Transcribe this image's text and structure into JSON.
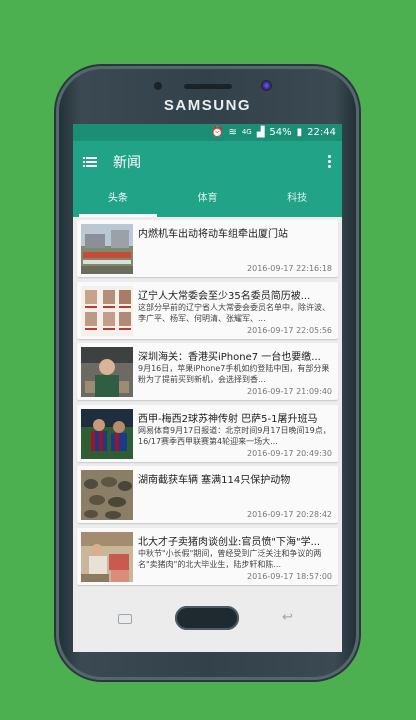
{
  "device": {
    "brand": "SAMSUNG"
  },
  "status_bar": {
    "network": "4G",
    "battery": "54%",
    "time": "22:44"
  },
  "app_bar": {
    "title": "新闻",
    "menu_icon": "hamburger-menu-icon",
    "more_icon": "more-vert-icon"
  },
  "tabs": [
    {
      "label": "头条",
      "active": true
    },
    {
      "label": "体育",
      "active": false
    },
    {
      "label": "科技",
      "active": false
    }
  ],
  "news": [
    {
      "title": "内燃机车出动将动车组牵出厦门站",
      "desc": "",
      "time": "2016-09-17 22:16:18"
    },
    {
      "title": "辽宁人大常委会至少35名委员简历被...",
      "desc": "这部分早前的辽宁省人大常委会委员名单中，除许波、李广平、杨军、何明清、张耀军、...",
      "time": "2016-09-17 22:05:56"
    },
    {
      "title": "深圳海关：香港买iPhone7 一台也要缴...",
      "desc": "9月16日，苹果iPhone7手机如约登陆中国，有部分果粉为了提前买到新机，会选择到香...",
      "time": "2016-09-17 21:09:40"
    },
    {
      "title": "西甲-梅西2球苏神传射 巴萨5-1屠升班马",
      "desc": "网易体育9月17日报道：北京时间9月17日晚间19点，16/17赛季西甲联赛第4轮迎来一场大...",
      "time": "2016-09-17 20:49:30"
    },
    {
      "title": "湖南截获车辆 塞满114只保护动物",
      "desc": "",
      "time": "2016-09-17 20:28:42"
    },
    {
      "title": "北大才子卖猪肉谈创业:官员愤\"下海\"学...",
      "desc": "中秋节\"小长假\"期间，曾经受到广泛关注和争议的两名\"卖猪肉\"的北大毕业生，陆步轩和陈...",
      "time": "2016-09-17 18:57:00"
    }
  ]
}
